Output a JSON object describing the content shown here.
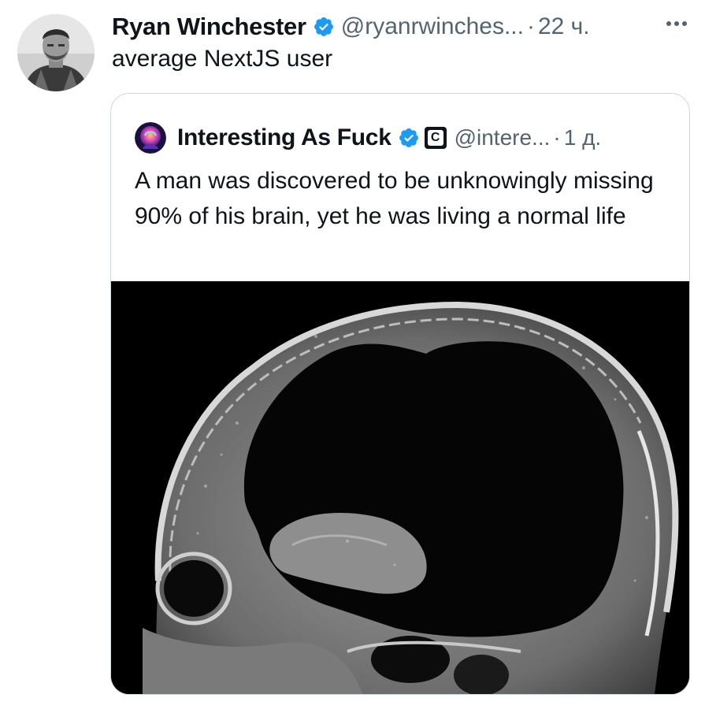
{
  "tweet": {
    "author_name": "Ryan Winchester",
    "author_handle": "@ryanrwinches...",
    "separator": "·",
    "time_ago": "22 ч.",
    "text": "average NextJS user",
    "verified_icon": "verified-badge-icon",
    "more_icon": "more-options-icon"
  },
  "quoted_tweet": {
    "author_name": "Interesting As Fuck",
    "author_handle": "@intere...",
    "separator": "·",
    "time_ago": "1 д.",
    "affiliate_label": "C",
    "text": "A man was discovered to be unknowingly missing 90% of his brain, yet he was living a normal life",
    "verified_icon": "verified-badge-icon",
    "media_icon": "mri-brain-scan-image"
  },
  "colors": {
    "text_primary": "#0f1419",
    "text_secondary": "#536471",
    "verified_blue": "#1d9bf0",
    "border": "#cfd9de"
  }
}
